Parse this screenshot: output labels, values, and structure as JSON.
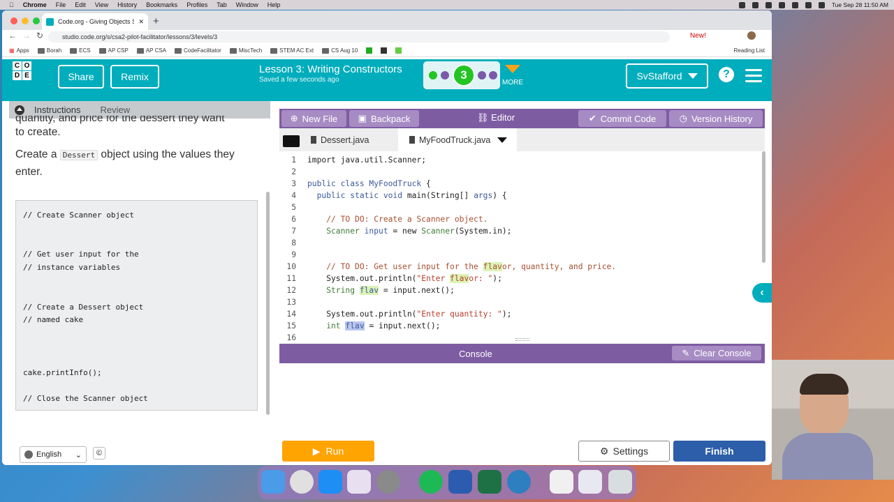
{
  "menubar": {
    "app": "Chrome",
    "items": [
      "File",
      "Edit",
      "View",
      "History",
      "Bookmarks",
      "Profiles",
      "Tab",
      "Window",
      "Help"
    ],
    "clock": "Tue Sep 28  11:50 AM"
  },
  "browser": {
    "tab_title": "Code.org - Giving Objects Stat",
    "url": "studio.code.org/s/csa2-pilot-facilitator/lessons/3/levels/3",
    "bookmarks": [
      "Apps",
      "Borah",
      "ECS",
      "AP CSP",
      "AP CSA",
      "CodeFacilitator",
      "MiscTech",
      "STEM AC Ext",
      "CS Aug 10"
    ],
    "reading_list": "Reading List",
    "new_badge": "New!"
  },
  "header": {
    "logo_letters": [
      "C",
      "O",
      "",
      "D",
      "E",
      ""
    ],
    "share": "Share",
    "remix": "Remix",
    "lesson_title": "Lesson 3: Writing Constructors",
    "saved": "Saved a few seconds ago",
    "current_level": "3",
    "more": "MORE",
    "user": "SvStafford",
    "help": "?"
  },
  "instructions": {
    "tab_instructions": "Instructions",
    "tab_review": "Review",
    "line_partial_1": "quantity, and price for the dessert they want",
    "line_partial_2": "to create.",
    "create_pre": "Create a ",
    "create_code": "Dessert",
    "create_post": " object using the values they",
    "create_end": "enter.",
    "code": [
      "// Create Scanner object",
      "",
      "",
      "// Get user input for the",
      "// instance variables",
      "",
      "",
      "// Create a Dessert object",
      "// named cake",
      "",
      "",
      "",
      "cake.printInfo();",
      "",
      "// Close the Scanner object"
    ]
  },
  "footer": {
    "language": "English",
    "copyright": "©"
  },
  "editor": {
    "new_file": "New File",
    "backpack": "Backpack",
    "label": "Editor",
    "commit": "Commit Code",
    "history": "Version History",
    "files": [
      "Dessert.java",
      "MyFoodTruck.java"
    ],
    "active_file": "MyFoodTruck.java",
    "line_numbers": [
      "1",
      "2",
      "3",
      "4",
      "5",
      "6",
      "7",
      "8",
      "9",
      "10",
      "11",
      "12",
      "13",
      "14",
      "15",
      "16"
    ],
    "lines": {
      "l1": "import java.util.Scanner;",
      "l3a": "public class ",
      "l3b": "MyFoodTruck",
      " l3c": " {",
      "l4a": "  public static void ",
      "l4b": "main",
      "l4c": "(String[] ",
      "l4d": "args",
      ") {": ") {",
      "l6": "    // TO DO: Create a Scanner object.",
      "l7a": "    Scanner ",
      "l7b": "input",
      " l7c": " = new ",
      "l7d": "Scanner",
      "l7e": "(System.in);",
      "l10a": "    // TO DO: Get user input for the ",
      "l10b": "flav",
      "l10c": "or, quantity, and price.",
      "l11a": "    System.out.println(",
      "l11b": "\"Enter ",
      "l11c": "flav",
      "l11d": "or: \"",
      "l11e": ");",
      "l12a": "    String ",
      "l12b": "flav",
      "l12c": " = input.next();",
      "l14a": "    System.out.println(",
      "l14b": "\"Enter quantity: \"",
      "l14c": ");",
      "l15a": "    int ",
      "l15b": "flav",
      "l15c": " = input.next();"
    },
    "console": "Console",
    "clear_console": "Clear Console",
    "run": "Run",
    "settings": "Settings",
    "finish": "Finish"
  }
}
